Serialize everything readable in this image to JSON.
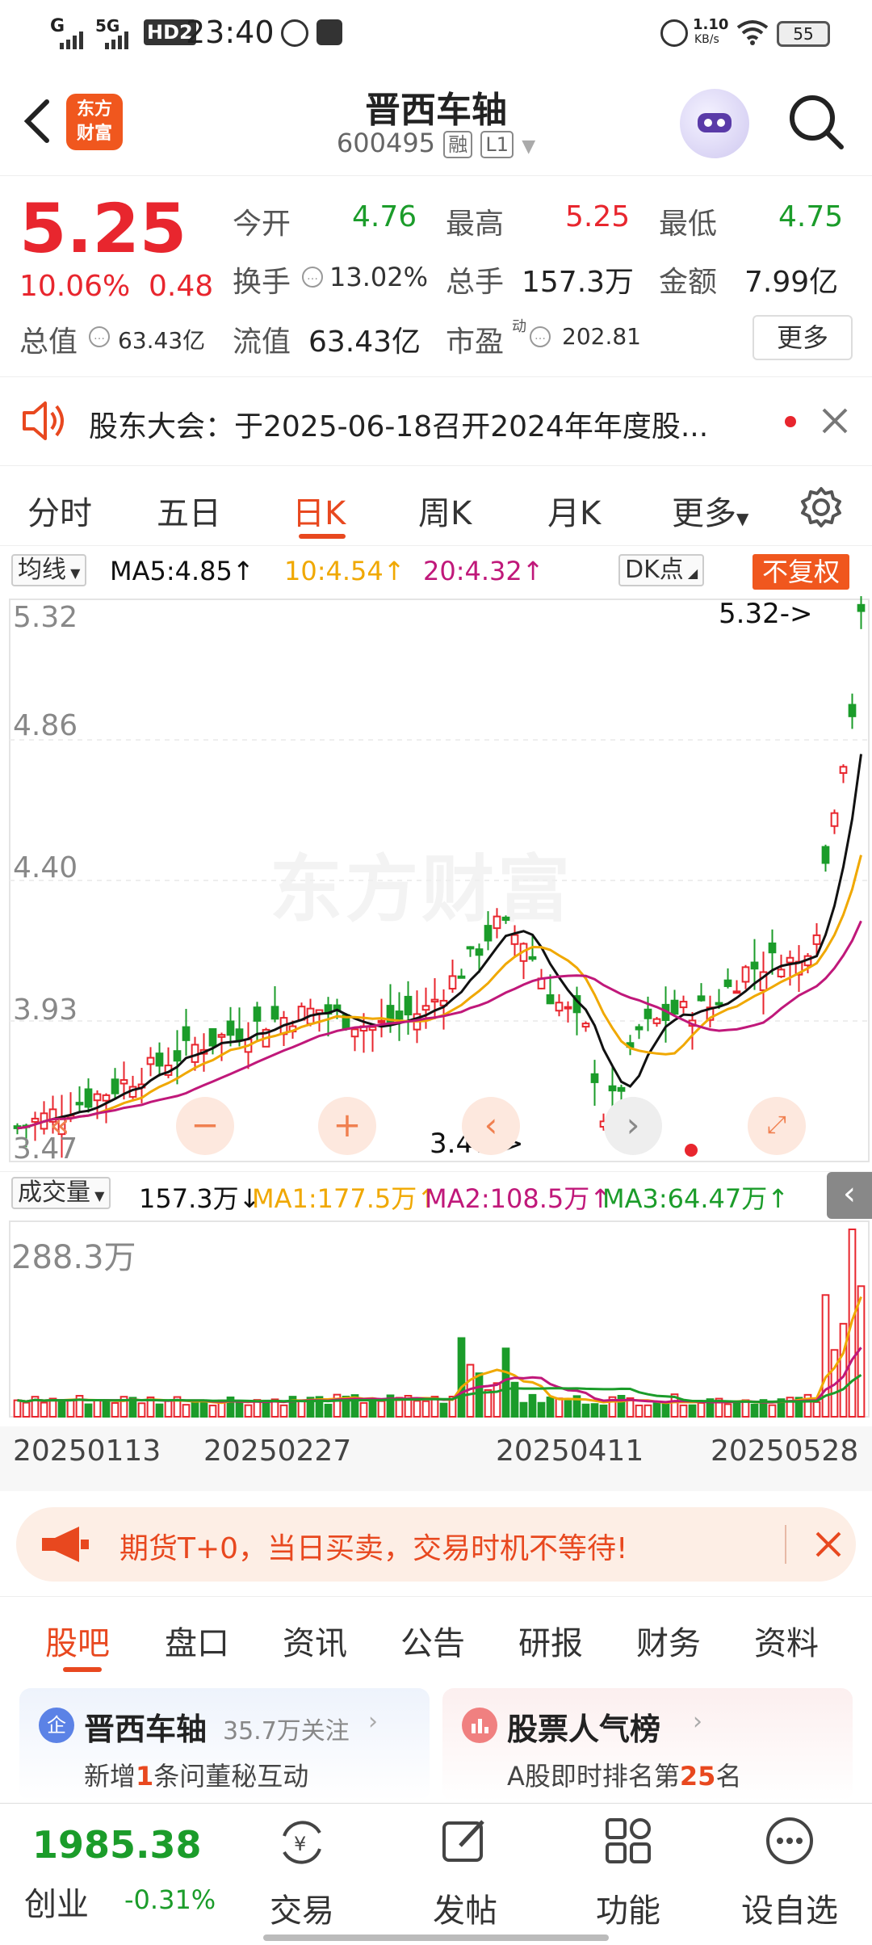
{
  "status_bar": {
    "signal": "G",
    "network": "5G",
    "hd": "HD2",
    "time": "23:40",
    "speed_value": "1.10",
    "speed_unit": "KB/s",
    "battery": "55"
  },
  "header": {
    "back_icon": "chevron-left-icon",
    "logo_line1": "东方",
    "logo_line2": "财富",
    "stock_name": "晋西车轴",
    "stock_code": "600495",
    "tag_margin": "融",
    "tag_level": "L1",
    "search_icon": "search-icon"
  },
  "quote": {
    "price": "5.25",
    "change_pct": "10.06%",
    "change_abs": "0.48",
    "open_label": "今开",
    "open_value": "4.76",
    "high_label": "最高",
    "high_value": "5.25",
    "low_label": "最低",
    "low_value": "4.75",
    "turnover_label": "换手",
    "turnover_value": "13.02%",
    "volume_label": "总手",
    "volume_value": "157.3万",
    "amount_label": "金额",
    "amount_value": "7.99亿",
    "mktcap_label": "总值",
    "mktcap_value": "63.43亿",
    "float_label": "流值",
    "float_value": "63.43亿",
    "pe_label": "市盈",
    "pe_sup": "动",
    "pe_value": "202.81",
    "more_button": "更多"
  },
  "notice": {
    "text": "股东大会：于2025-06-18召开2024年年度股..."
  },
  "chart_tabs": [
    "分时",
    "五日",
    "日K",
    "周K",
    "月K",
    "更多"
  ],
  "active_tab": "日K",
  "ma_bar": {
    "selector": "均线",
    "ma5": "MA5:4.85↑",
    "ma10": "10:4.54↑",
    "ma20": "20:4.32↑",
    "dk": "DK点",
    "adjust": "不复权"
  },
  "vol_bar": {
    "selector": "成交量",
    "vol": "157.3万↓",
    "ma1": "MA1:177.5万↑",
    "ma2": "MA2:108.5万↑",
    "ma3": "MA3:64.47万↑"
  },
  "watermark": "东方财富",
  "chart_data": {
    "type": "candlestick",
    "y_ticks": [
      "5.32",
      "4.86",
      "4.40",
      "3.93",
      "3.47"
    ],
    "ylim": [
      3.47,
      5.32
    ],
    "high_marker": "5.32->",
    "low_marker": "3.47->",
    "volume_max_label": "288.3万",
    "x_labels": [
      "20250113",
      "20250227",
      "20250411",
      "20250528"
    ],
    "colors": {
      "up": "#e8262e",
      "down": "#1b9c2a",
      "ma5": "#111111",
      "ma10": "#f0a800",
      "ma20": "#c0187a"
    }
  },
  "banner": {
    "text": "期货T+0，当日买卖，交易时机不等待!"
  },
  "bottom_tabs": [
    "股吧",
    "盘口",
    "资讯",
    "公告",
    "研报",
    "财务",
    "资料"
  ],
  "active_bottom_tab": "股吧",
  "cards": {
    "left_title": "晋西车轴",
    "left_follow": "35.7万关注",
    "left_desc_pre": "新增",
    "left_desc_num": "1",
    "left_desc_post": "条问董秘互动",
    "right_title": "股票人气榜",
    "right_desc_pre": "A股即时排名第",
    "right_desc_num": "25",
    "right_desc_post": "名"
  },
  "bottom_nav": {
    "index_value": "1985.38",
    "index_name": "创业",
    "index_change": "-0.31%",
    "items": [
      "交易",
      "发帖",
      "功能",
      "设自选"
    ]
  }
}
